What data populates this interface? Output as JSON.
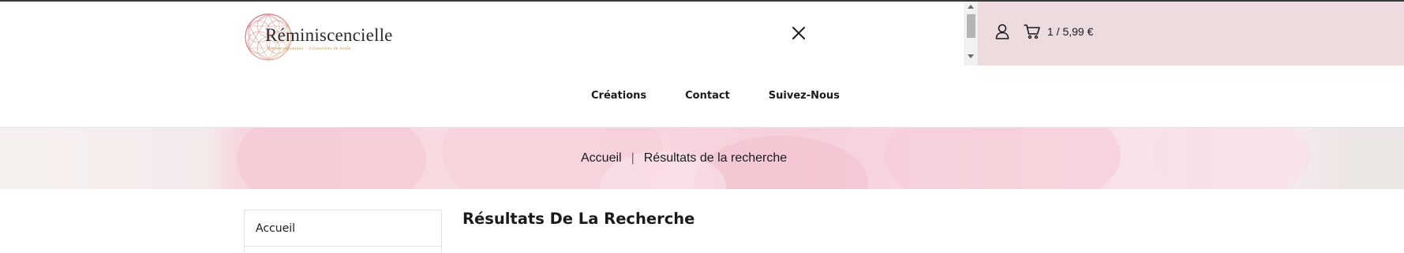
{
  "header": {
    "logo_text": "Réminiscencielle",
    "logo_tagline": "Bijoux artisanaux · Accessoires de mode",
    "cart_label": "1 / 5,99 €"
  },
  "nav": {
    "items": [
      {
        "label": "Créations"
      },
      {
        "label": "Contact"
      },
      {
        "label": "Suivez-Nous"
      }
    ]
  },
  "breadcrumb": {
    "home": "Accueil",
    "separator": "|",
    "current": "Résultats de la recherche"
  },
  "sidebar": {
    "items": [
      {
        "label": "Accueil"
      }
    ]
  },
  "main": {
    "title": "Résultats De La Recherche"
  },
  "colors": {
    "account_panel": "#ecdcdd",
    "banner_pink": "#f7d7de",
    "logo_accent": "#c9a36b"
  },
  "icons": {
    "close": "close-icon",
    "user": "user-icon",
    "cart": "cart-icon"
  }
}
